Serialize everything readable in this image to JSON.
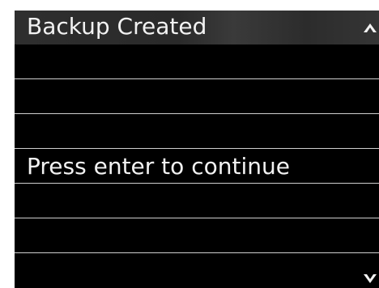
{
  "title": "Backup Created",
  "lines": [
    "",
    "",
    "",
    "Press enter to continue",
    "",
    "",
    ""
  ],
  "icons": {
    "scroll_up": "chevron-up-icon",
    "scroll_down": "chevron-down-icon"
  },
  "colors": {
    "background": "#000000",
    "title_bar": "#2e2e2e",
    "text": "#f2f2f2",
    "divider": "#cfcfcf"
  }
}
